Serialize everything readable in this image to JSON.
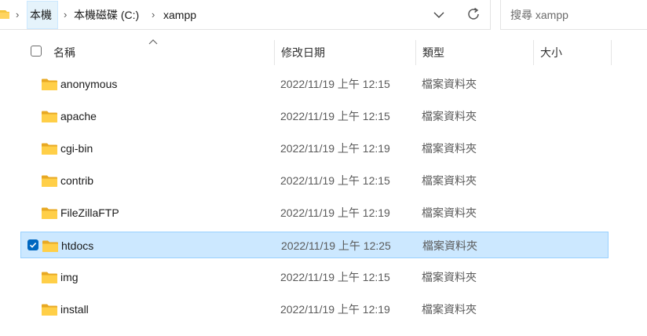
{
  "breadcrumb": {
    "items": [
      "本機",
      "本機磁碟 (C:)",
      "xampp"
    ]
  },
  "search": {
    "placeholder": "搜尋 xampp"
  },
  "columns": {
    "name": "名稱",
    "date": "修改日期",
    "type": "類型",
    "size": "大小"
  },
  "files": [
    {
      "name": "anonymous",
      "date": "2022/11/19 上午 12:15",
      "type": "檔案資料夾",
      "selected": false
    },
    {
      "name": "apache",
      "date": "2022/11/19 上午 12:15",
      "type": "檔案資料夾",
      "selected": false
    },
    {
      "name": "cgi-bin",
      "date": "2022/11/19 上午 12:19",
      "type": "檔案資料夾",
      "selected": false
    },
    {
      "name": "contrib",
      "date": "2022/11/19 上午 12:15",
      "type": "檔案資料夾",
      "selected": false
    },
    {
      "name": "FileZillaFTP",
      "date": "2022/11/19 上午 12:19",
      "type": "檔案資料夾",
      "selected": false
    },
    {
      "name": "htdocs",
      "date": "2022/11/19 上午 12:25",
      "type": "檔案資料夾",
      "selected": true
    },
    {
      "name": "img",
      "date": "2022/11/19 上午 12:15",
      "type": "檔案資料夾",
      "selected": false
    },
    {
      "name": "install",
      "date": "2022/11/19 上午 12:19",
      "type": "檔案資料夾",
      "selected": false
    }
  ],
  "colors": {
    "selection_bg": "#cce8ff",
    "selection_border": "#99d1ff",
    "checkbox_accent": "#0067c0",
    "folder_yellow": "#f4c53e"
  }
}
